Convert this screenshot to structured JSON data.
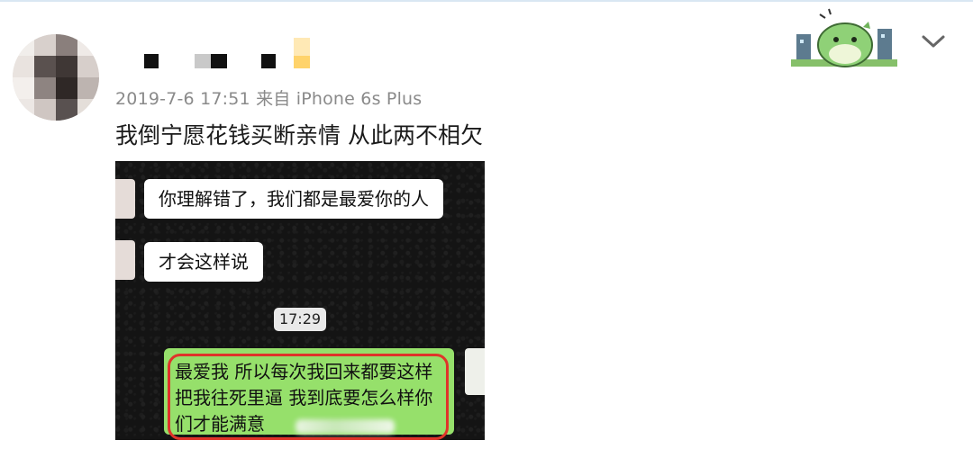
{
  "post": {
    "timestamp_source": "2019-7-6 17:51 来自 iPhone 6s Plus",
    "text": "我倒宁愿花钱买断亲情 从此两不相欠"
  },
  "chat": {
    "msg1": "你理解错了，我们都是最爱你的人",
    "msg2": "才会这样说",
    "time": "17:29",
    "reply_line1": "最爱我 所以每次我回来都要这样",
    "reply_line2": "把我往死里逼 我到底要怎么样你",
    "reply_line3": "们才能满意"
  },
  "icons": {
    "avatar": "user-avatar-blurred",
    "sticker": "green-dinosaur-sticker",
    "menu": "chevron-down-icon"
  },
  "colors": {
    "meta": "#8a8a8a",
    "chat_green": "#96e06b",
    "highlight_red": "#e0342a"
  }
}
